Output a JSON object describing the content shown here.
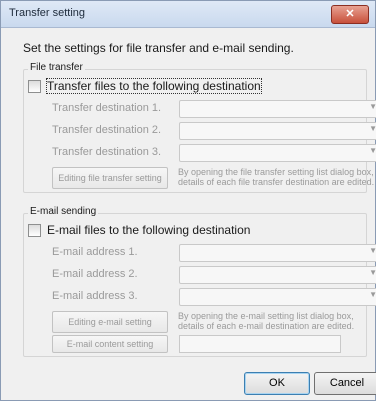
{
  "window": {
    "title": "Transfer setting",
    "close_glyph": "✕"
  },
  "intro_text": "Set the settings for file transfer and e-mail sending.",
  "file_transfer": {
    "legend": "File transfer",
    "checkbox_label": "Transfer files to the following destination",
    "rows": [
      {
        "label": "Transfer destination 1.",
        "value": ""
      },
      {
        "label": "Transfer destination 2.",
        "value": ""
      },
      {
        "label": "Transfer destination 3.",
        "value": ""
      }
    ],
    "edit_button": "Editing file transfer setting",
    "help_text": "By opening the file transfer setting list dialog box, details of each file transfer destination are edited."
  },
  "email": {
    "legend": "E-mail sending",
    "checkbox_label": "E-mail files to the following destination",
    "rows": [
      {
        "label": "E-mail address 1.",
        "value": ""
      },
      {
        "label": "E-mail address 2.",
        "value": ""
      },
      {
        "label": "E-mail address 3.",
        "value": ""
      }
    ],
    "edit_button": "Editing e-mail setting",
    "help_text": "By opening the e-mail setting list dialog box, details of each e-mail destination are edited.",
    "content_button": "E-mail content setting",
    "content_value": ""
  },
  "footer": {
    "ok_label": "OK",
    "cancel_label": "Cancel"
  },
  "icons": {
    "dropdown": "chevron-down-icon",
    "close": "close-icon"
  },
  "colors": {
    "disabled_text": "#9a9a9a",
    "close_button": "#c7503b"
  }
}
